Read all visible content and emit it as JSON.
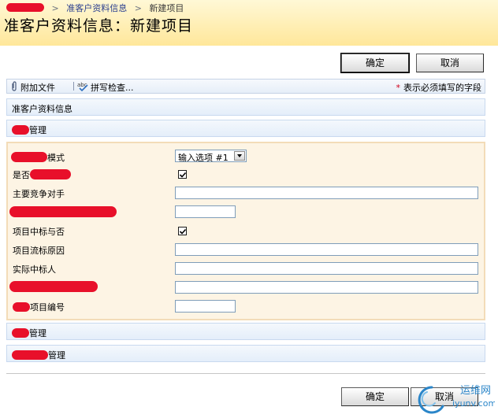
{
  "breadcrumb": {
    "items": [
      "准客户资料信息",
      "新建项目"
    ],
    "separator": ">"
  },
  "page_title": "准客户资料信息：新建项目",
  "top_actions": {
    "ok": "确定",
    "cancel": "取消"
  },
  "toolbar": {
    "attach": "附加文件",
    "spell": "拼写检查...",
    "required_star": "*",
    "required_note": "表示必须填写的字段"
  },
  "sections": {
    "info": "准客户资料信息",
    "mgmt1_suffix": "管理",
    "mgmt2_suffix": "管理",
    "mgmt3_suffix": "管理"
  },
  "form": {
    "mode_suffix": "模式",
    "mode_select": "输入选项 #1",
    "shifou_prefix": "是否",
    "competitor_label": "主要竞争对手",
    "bid_win_label": "项目中标与否",
    "fail_reason_label": "项目流标原因",
    "actual_winner_label": "实际中标人",
    "project_no_label": "项目编号"
  },
  "bottom_actions": {
    "ok": "确定",
    "cancel": "取消"
  },
  "watermark": {
    "line1": "运维网",
    "line2": "iyunv.com"
  },
  "colors": {
    "header_bg": "#ffe79a",
    "form_bg": "#fdf4e4",
    "section_bg": "#e4eefa",
    "required": "#d0021b"
  }
}
